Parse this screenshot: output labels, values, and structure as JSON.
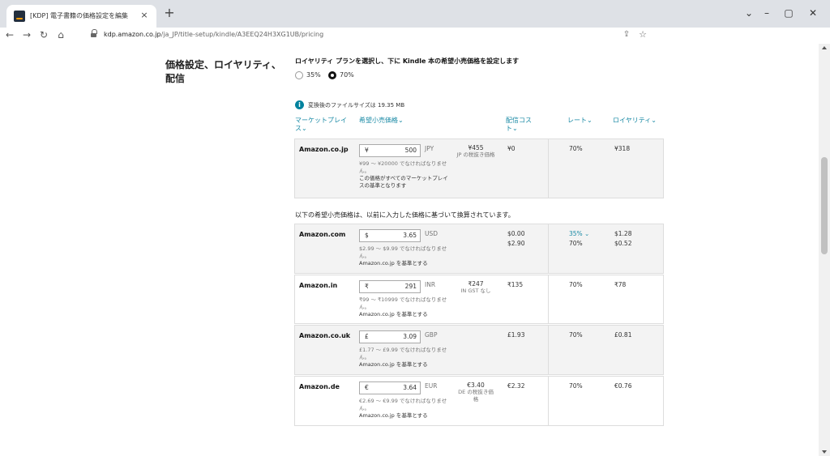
{
  "browser": {
    "tab_title": "[KDP] 電子書籍の価格設定を編集",
    "tab_close": "×",
    "new_tab": "+",
    "url_host": "kdp.amazon.co.jp",
    "url_path": "/ja_JP/title-setup/kindle/A3EEQ24H3XG1UB/pricing",
    "win_min": "–",
    "win_max": "▢",
    "win_close": "✕",
    "win_menu": "⌄"
  },
  "section": {
    "title": "価格設定、ロイヤリティ、配信",
    "plan_heading": "ロイヤリティ プランを選択し、下に Kindle 本の希望小売価格を設定します",
    "plans": [
      {
        "label": "35%",
        "selected": false
      },
      {
        "label": "70%",
        "selected": true
      }
    ],
    "file_size_note": "変換後のファイルサイズは 19.35 MB",
    "columns": {
      "marketplace": "マーケットプレイス⌄",
      "list_price": "希望小売価格⌄",
      "delivery": "配信コスト⌄",
      "rate": "レート⌄",
      "royalty": "ロイヤリティ⌄"
    },
    "primary": {
      "name": "Amazon.co.jp",
      "symbol": "¥",
      "price": "500",
      "currency": "JPY",
      "tax_price": "¥455",
      "tax_sub": "JP の税抜き価格",
      "delivery": "¥0",
      "rate": "70%",
      "royalty": "¥318",
      "note": "¥99 ～ ¥20000 でなければなりません。",
      "note_basis": "この価格がすべてのマーケットプレイスの基準となります"
    },
    "converted_note": "以下の希望小売価格は、以前に入力した価格に基づいて換算されています。",
    "marketplaces": [
      {
        "name": "Amazon.com",
        "symbol": "$",
        "price": "3.65",
        "currency": "USD",
        "tax_price": "",
        "tax_sub": "",
        "delivery": [
          "$0.00",
          "$2.90"
        ],
        "rate": [
          "35% ⌄",
          "70%"
        ],
        "royalty": [
          "$1.28",
          "$0.52"
        ],
        "note": "$2.99 ～ $9.99 でなければなりません。",
        "basis": "Amazon.co.jp を基準とする"
      },
      {
        "name": "Amazon.in",
        "symbol": "₹",
        "price": "291",
        "currency": "INR",
        "tax_price": "₹247",
        "tax_sub": "IN GST なし",
        "delivery": [
          "₹135"
        ],
        "rate": [
          "70%"
        ],
        "royalty": [
          "₹78"
        ],
        "note": "₹99 ～ ₹10999 でなければなりません。",
        "basis": "Amazon.co.jp を基準とする"
      },
      {
        "name": "Amazon.co.uk",
        "symbol": "£",
        "price": "3.09",
        "currency": "GBP",
        "tax_price": "",
        "tax_sub": "",
        "delivery": [
          "£1.93"
        ],
        "rate": [
          "70%"
        ],
        "royalty": [
          "£0.81"
        ],
        "note": "£1.77 ～ £9.99 でなければなりません。",
        "basis": "Amazon.co.jp を基準とする"
      },
      {
        "name": "Amazon.de",
        "symbol": "€",
        "price": "3.64",
        "currency": "EUR",
        "tax_price": "€3.40",
        "tax_sub": "DE の税抜き価格",
        "delivery": [
          "€2.32"
        ],
        "rate": [
          "70%"
        ],
        "royalty": [
          "€0.76"
        ],
        "note": "€2.69 ～ €9.99 でなければなりません。",
        "basis": "Amazon.co.jp を基準とする"
      }
    ]
  }
}
